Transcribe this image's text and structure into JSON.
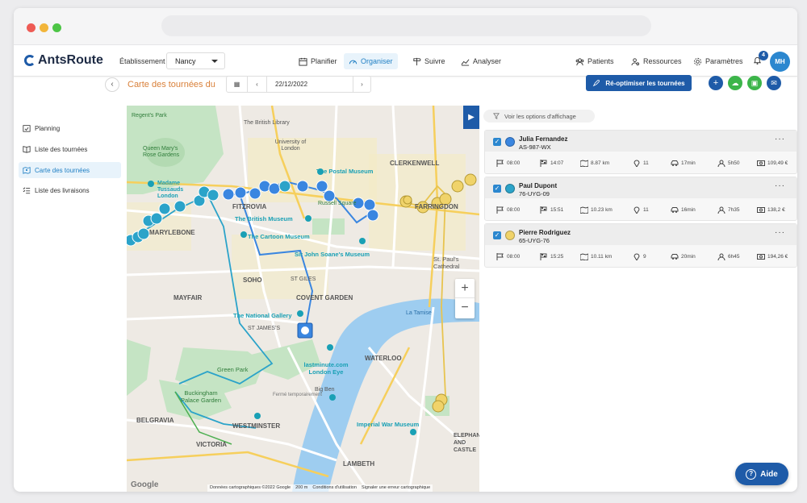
{
  "brand": {
    "name": "AntsRoute"
  },
  "establishment": {
    "label": "Établissement",
    "value": "Nancy"
  },
  "nav": {
    "items": [
      {
        "label": "Planifier"
      },
      {
        "label": "Organiser"
      },
      {
        "label": "Suivre"
      },
      {
        "label": "Analyser"
      }
    ],
    "right": [
      {
        "label": "Patients"
      },
      {
        "label": "Ressources"
      },
      {
        "label": "Paramètres"
      }
    ],
    "notifications": "4",
    "avatar": "MH"
  },
  "sidebar": {
    "items": [
      {
        "label": "Planning"
      },
      {
        "label": "Liste des tournées"
      },
      {
        "label": "Carte des tournées"
      },
      {
        "label": "Liste des livraisons"
      }
    ]
  },
  "toolbar": {
    "title": "Carte des tournées du",
    "date": "22/12/2022",
    "reoptimize": "Ré-optimiser les tournées"
  },
  "map": {
    "labels": [
      "CLERKENWELL",
      "FITZROVIA",
      "MARYLEBONE",
      "SOHO",
      "MAYFAIR",
      "COVENT GARDEN",
      "ST JAMES'S",
      "WESTMINSTER",
      "BELGRAVIA",
      "VICTORIA",
      "LAMBETH",
      "WATERLOO",
      "ELEPHANT AND CASTLE",
      "ST GILES",
      "FARRINGDON"
    ],
    "pois": [
      "Regent's Park",
      "Queen Mary's Rose Gardens",
      "Madame Tussauds London",
      "The British Library",
      "University of London",
      "The Postal Museum",
      "The British Museum",
      "The Cartoon Museum",
      "Sir John Soane's Museum",
      "St. Paul's Cathedral",
      "Russell Square",
      "The National Gallery",
      "Green Park",
      "Buckingham Palace Garden",
      "lastminute.com London Eye",
      "Big Ben",
      "Imperial War Museum",
      "La Tamise",
      "Fermé temporairement"
    ],
    "footer": [
      "Données cartographiques ©2022 Google",
      "200 m",
      "Conditions d'utilisation",
      "Signaler une erreur cartographique"
    ]
  },
  "panel": {
    "options_label": "Voir les options d'affichage",
    "tours": [
      {
        "name": "Julia Fernandez",
        "plate": "AS-987-WX",
        "color": "#3a86e0",
        "start": "08:00",
        "end": "14:07",
        "distance": "8.87 km",
        "stops": "11",
        "drive": "17min",
        "duration": "5h50",
        "cost": "109,49 €"
      },
      {
        "name": "Paul Dupont",
        "plate": "76-UYG-09",
        "color": "#2ba3c9",
        "start": "08:00",
        "end": "15:51",
        "distance": "10.23 km",
        "stops": "11",
        "drive": "16min",
        "duration": "7h35",
        "cost": "138,2 €"
      },
      {
        "name": "Pierre Rodriguez",
        "plate": "65-UYG-76",
        "color": "#f0d36a",
        "start": "08:00",
        "end": "15:25",
        "distance": "10.11 km",
        "stops": "9",
        "drive": "20min",
        "duration": "6h45",
        "cost": "194,26 €"
      }
    ]
  },
  "help": {
    "label": "Aide"
  }
}
